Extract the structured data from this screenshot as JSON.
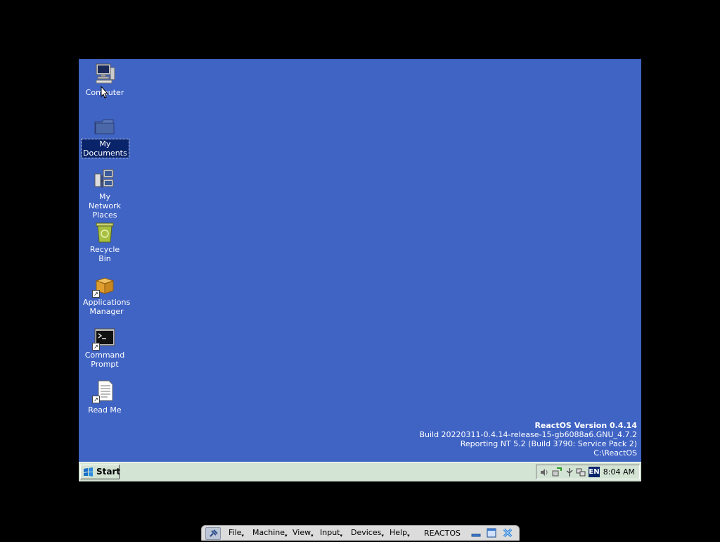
{
  "desktop": {
    "background": "#4064c4",
    "icons": [
      {
        "name": "computer",
        "label": "Computer",
        "icon": "computer-icon"
      },
      {
        "name": "my-documents",
        "label": "My\nDocuments",
        "icon": "folder-icon",
        "selected": true
      },
      {
        "name": "my-network-places",
        "label": "My Network\nPlaces",
        "icon": "network-places-icon"
      },
      {
        "name": "recycle-bin",
        "label": "Recycle Bin",
        "icon": "recycle-bin-icon"
      },
      {
        "name": "applications-manager",
        "label": "Applications\nManager",
        "icon": "package-box-icon",
        "shortcut": true
      },
      {
        "name": "command-prompt",
        "label": "Command\nPrompt",
        "icon": "terminal-icon",
        "shortcut": true
      },
      {
        "name": "read-me",
        "label": "Read Me",
        "icon": "document-icon",
        "shortcut": true
      }
    ]
  },
  "version_info": {
    "title": "ReactOS Version 0.4.14",
    "build": "Build 20220311-0.4.14-release-15-gb6088a6.GNU_4.7.2",
    "reporting": "Reporting NT 5.2 (Build 3790: Service Pack 2)",
    "path": "C:\\ReactOS"
  },
  "taskbar": {
    "start_label": "Start",
    "tray": {
      "icons": [
        "volume-icon",
        "network-connection-icon",
        "usb-device-icon",
        "network-monitor-icon"
      ],
      "language": "EN",
      "clock": "8:04 AM"
    }
  },
  "vbox_bar": {
    "menus": [
      "File",
      "Machine",
      "View",
      "Input",
      "Devices",
      "Help"
    ],
    "title": "REACTOS",
    "buttons": [
      "minimize-icon",
      "restore-icon",
      "close-icon"
    ]
  },
  "colors": {
    "desktop": "#4064c4",
    "taskbar": "#d4e4d4",
    "selection": "#0a246a"
  }
}
